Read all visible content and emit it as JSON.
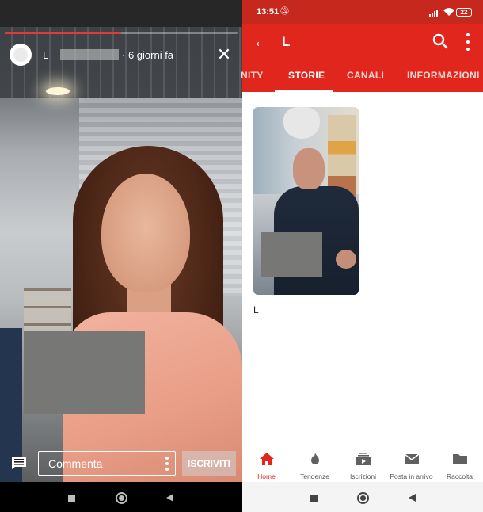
{
  "left_story": {
    "channel_initial": "L",
    "time_ago": "· 6 giorni fa",
    "progress": 0.5,
    "comment_placeholder": "Commenta",
    "subscribe_label": "ISCRIVITI"
  },
  "right_channel": {
    "status": {
      "time": "13:51",
      "battery": "22"
    },
    "title": "L",
    "tabs": [
      {
        "label": "NITY"
      },
      {
        "label": "STORIE"
      },
      {
        "label": "CANALI"
      },
      {
        "label": "INFORMAZIONI"
      }
    ],
    "story_caption": "L",
    "bottom_nav": [
      {
        "label": "Home",
        "icon": "home-icon"
      },
      {
        "label": "Tendenze",
        "icon": "flame-icon"
      },
      {
        "label": "Iscrizioni",
        "icon": "subscriptions-icon"
      },
      {
        "label": "Posta in arrivo",
        "icon": "mail-icon"
      },
      {
        "label": "Raccolta",
        "icon": "folder-icon"
      }
    ]
  },
  "colors": {
    "brand_red": "#e1261d",
    "status_red": "#c6281e",
    "progress_red": "#e53935"
  }
}
